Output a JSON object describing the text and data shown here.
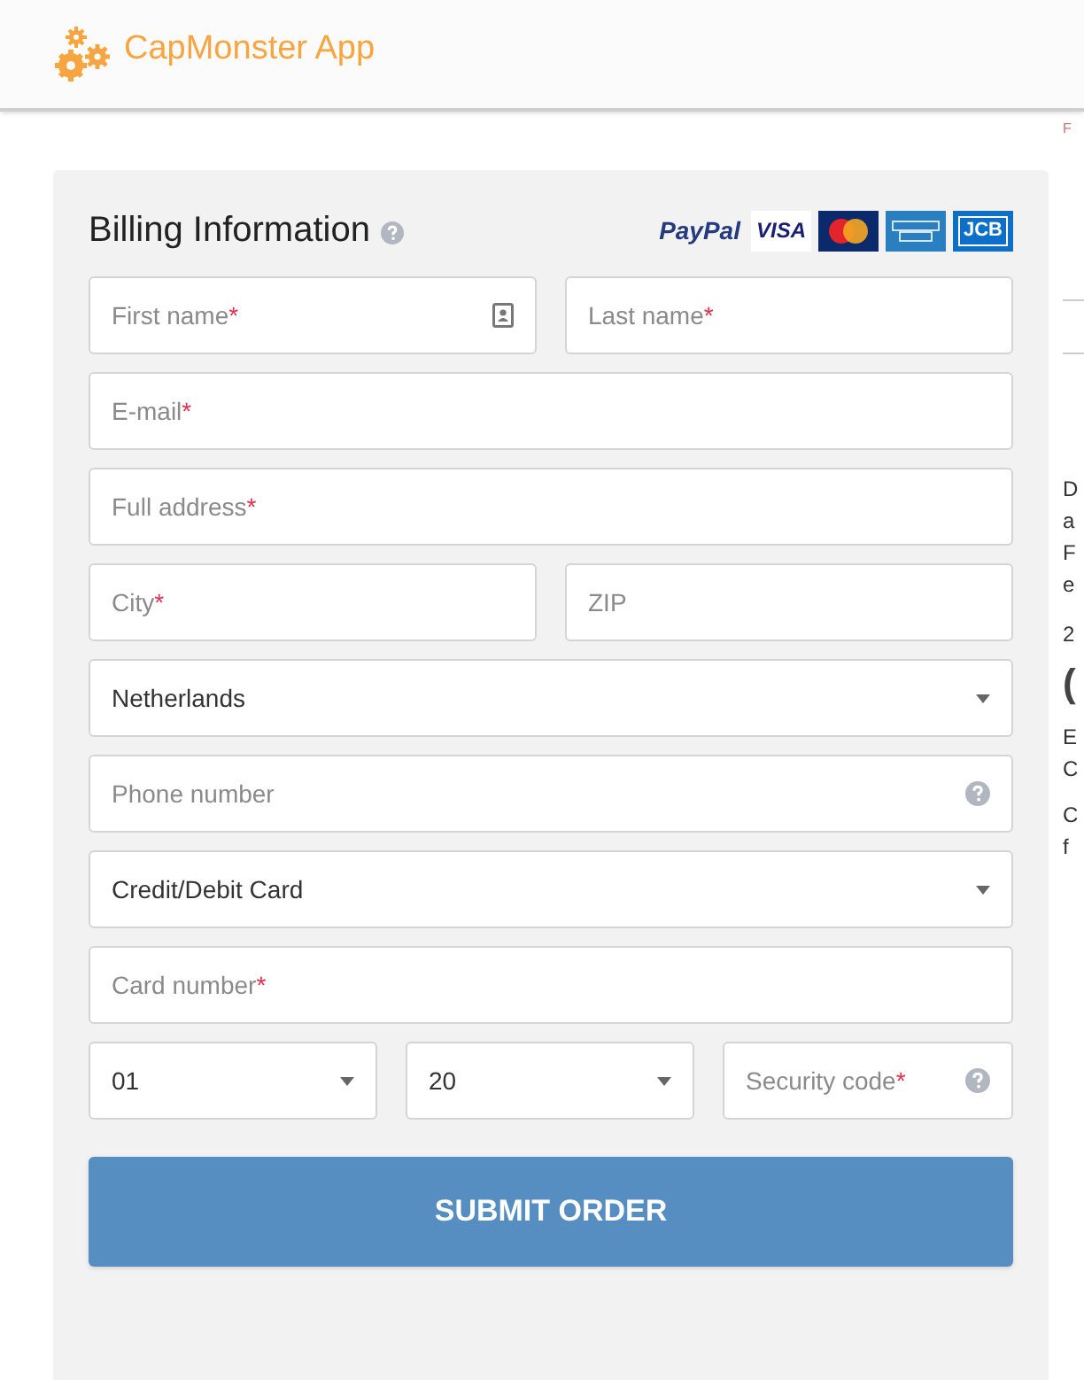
{
  "header": {
    "app_name": "CapMonster App"
  },
  "billing": {
    "title": "Billing Information",
    "payment_logos": [
      {
        "kind": "paypal",
        "text": "PayPal"
      },
      {
        "kind": "visa",
        "text": "VISA"
      },
      {
        "kind": "mastercard"
      },
      {
        "kind": "amex"
      },
      {
        "kind": "jcb",
        "text": "JCB"
      }
    ],
    "rows": [
      [
        {
          "kind": "text",
          "placeholder": "First name",
          "required_mark": "*",
          "contact_card": true
        },
        {
          "kind": "text",
          "placeholder": "Last name",
          "required_mark": "*"
        }
      ],
      [
        {
          "kind": "text",
          "placeholder": "E-mail",
          "required_mark": "*"
        }
      ],
      [
        {
          "kind": "text",
          "placeholder": "Full address",
          "required_mark": "*"
        }
      ],
      [
        {
          "kind": "text",
          "placeholder": "City",
          "required_mark": "*"
        },
        {
          "kind": "text",
          "placeholder": "ZIP"
        }
      ],
      [
        {
          "kind": "select",
          "value": "Netherlands"
        }
      ],
      [
        {
          "kind": "text",
          "placeholder": "Phone number",
          "help": true
        }
      ],
      [
        {
          "kind": "select",
          "value": "Credit/Debit Card"
        }
      ],
      [
        {
          "kind": "text",
          "placeholder": "Card number",
          "required_mark": "*"
        }
      ],
      [
        {
          "kind": "select",
          "value": "01"
        },
        {
          "kind": "select",
          "value": "20"
        },
        {
          "kind": "text",
          "placeholder": "Security code",
          "required_mark": "*",
          "help": true
        }
      ]
    ],
    "submit": "SUBMIT ORDER"
  },
  "side_column": {
    "top_fragment": "F",
    "fragments": [
      [
        "D",
        "a",
        "F",
        "e"
      ],
      [
        "2"
      ],
      [
        "("
      ],
      [
        "E",
        "C"
      ],
      [
        "C",
        "f"
      ]
    ]
  }
}
